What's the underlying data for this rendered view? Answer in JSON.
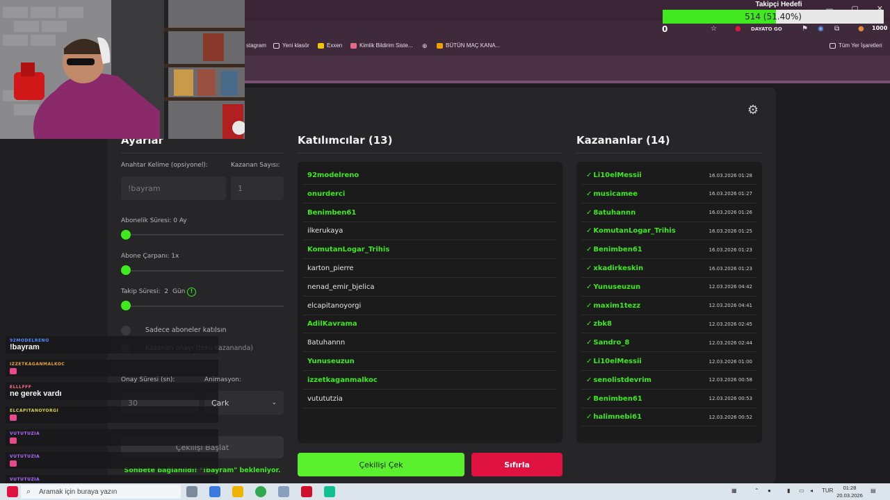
{
  "browser": {
    "bookmarks": [
      "stagram",
      "Yeni klasör",
      "Exxen",
      "Kimlik Bildirim Siste...",
      "",
      "BÜTÜN MAÇ KANA...",
      "Tüm Yer İşaretleri"
    ],
    "toolbar_text": "DAYATO GO",
    "counter": "1000"
  },
  "follow_goal": {
    "title": "Takipçi Hedefi",
    "progress_text": "514 (51.40%)",
    "progress": 0.514,
    "start_label": "0"
  },
  "settings": {
    "title": "Ayarlar",
    "keyword_label": "Anahtar Kelime (opsiyonel):",
    "keyword_placeholder": "!bayram",
    "winners_count_label": "Kazanan Sayısı:",
    "winners_count_value": "1",
    "sub_duration_label": "Abonelik Süresi: 0 Ay",
    "sub_duration_level": 0,
    "sub_multiplier_label": "Abone Çarpanı: 1x",
    "sub_multiplier_level": 0,
    "follow_duration_label": "Takip Süresi:",
    "follow_duration_value": "2",
    "follow_duration_unit": "Gün",
    "follow_info_icon": "!",
    "follow_duration_level": 0,
    "subs_only_label": "Sadece aboneler katılsın",
    "winner_confirm_label": "Kazanan onayı (tekli kazananda)",
    "confirm_time_label": "Onay Süresi (sn):",
    "confirm_time_value": "30",
    "animation_label": "Animasyon:",
    "animation_value": "Çark",
    "start_button": "Çekilişi Başlat",
    "status_text": "Sohbete bağlanıldı! \"!bayram\" bekleniyor."
  },
  "participants": {
    "title": "Katılımcılar (13)",
    "items": [
      {
        "name": "92modelreno",
        "highlight": true
      },
      {
        "name": "onurderci",
        "highlight": true
      },
      {
        "name": "Benimben61",
        "highlight": true
      },
      {
        "name": "ilkerukaya",
        "highlight": false
      },
      {
        "name": "KomutanLogar_Trihis",
        "highlight": true
      },
      {
        "name": "karton_pierre",
        "highlight": false
      },
      {
        "name": "nenad_emir_bjelica",
        "highlight": false
      },
      {
        "name": "elcapitanoyorgi",
        "highlight": false
      },
      {
        "name": "AdilKavrama",
        "highlight": true
      },
      {
        "name": "8atuhannn",
        "highlight": false
      },
      {
        "name": "Yunuseuzun",
        "highlight": true
      },
      {
        "name": "izzetkaganmalkoc",
        "highlight": true
      },
      {
        "name": "vutututzia",
        "highlight": false
      }
    ]
  },
  "winners": {
    "title": "Kazananlar (14)",
    "check": "✓",
    "items": [
      {
        "name": "Li10elMessii",
        "date": "16.03.2026 01:28"
      },
      {
        "name": "musicamee",
        "date": "16.03.2026 01:27"
      },
      {
        "name": "8atuhannn",
        "date": "16.03.2026 01:26"
      },
      {
        "name": "KomutanLogar_Trihis",
        "date": "16.03.2026 01:25"
      },
      {
        "name": "Benimben61",
        "date": "16.03.2026 01:23"
      },
      {
        "name": "xkadirkeskin",
        "date": "16.03.2026 01:23"
      },
      {
        "name": "Yunuseuzun",
        "date": "12.03.2026 04:42"
      },
      {
        "name": "maxim1tezz",
        "date": "12.03.2026 04:41"
      },
      {
        "name": "zbk8",
        "date": "12.03.2026 02:45"
      },
      {
        "name": "Sandro_8",
        "date": "12.03.2026 02:44"
      },
      {
        "name": "Li10elMessii",
        "date": "12.03.2026 01:00"
      },
      {
        "name": "senolistdevrim",
        "date": "12.03.2026 00:58"
      },
      {
        "name": "Benimben61",
        "date": "12.03.2026 00:53"
      },
      {
        "name": "halimnebi61",
        "date": "12.03.2026 00:52"
      }
    ]
  },
  "actions": {
    "draw_button": "Çekilişi Çek",
    "reset_button": "Sıfırla"
  },
  "chat": [
    {
      "user": "92MODELRENO",
      "text": "!bayram",
      "color": "#4f8fff"
    },
    {
      "user": "IZZETKAGANMALKOC",
      "text": "",
      "color": "#e8a13a"
    },
    {
      "user": "ELLLFFF",
      "text": "ne gerek vardı",
      "color": "#ff6b8b"
    },
    {
      "user": "ELCAPITANOYORGI",
      "text": "",
      "color": "#d9d24a"
    },
    {
      "user": "VUTUTUZIA",
      "text": "",
      "color": "#b06bff"
    },
    {
      "user": "VUTUTUZIA",
      "text": "",
      "color": "#b06bff"
    },
    {
      "user": "VUTUTUZIA",
      "text": "",
      "color": "#b06bff"
    }
  ],
  "taskbar": {
    "search_placeholder": "Aramak için buraya yazın",
    "language": "TUR",
    "time": "01:28",
    "date": "20.03.2026"
  },
  "colors": {
    "accent_green": "#3fe81f",
    "danger_red": "#e0123f",
    "panel": "#262628"
  }
}
